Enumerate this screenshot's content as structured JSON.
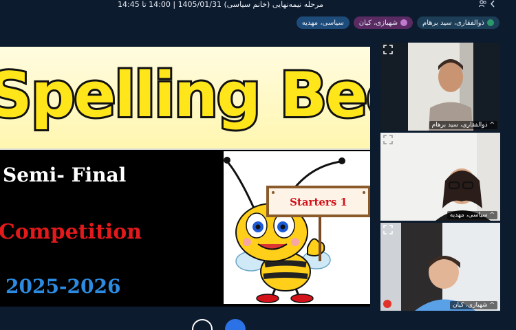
{
  "session": {
    "title": "مرحله نیمه‌نهایی (خانم سیاسی) 1405/01/31 | 14:00 تا 14:45"
  },
  "top_icons": [
    "chevron-left-icon",
    "people-icon"
  ],
  "participants_bar": [
    {
      "name": "سیاسی، مهدیه"
    },
    {
      "name": "شهبازی، کیان"
    },
    {
      "name": "ذوالفقاری، سید برهام"
    }
  ],
  "slide": {
    "banner_text": "Spelling Bee",
    "line1": "Semi- Final",
    "line2": "Competition",
    "line3": "2025-2026",
    "sign_text": "Starters 1",
    "colors": {
      "banner_fill": "#ffe61a",
      "competition": "#e3191b",
      "year": "#2c8be0"
    }
  },
  "video_tiles": [
    {
      "name": "^ ذوالفقاری، سید برهام"
    },
    {
      "name": "^ سیاسی، مهدیه"
    },
    {
      "name": "^ شهبازی، کیان"
    }
  ]
}
